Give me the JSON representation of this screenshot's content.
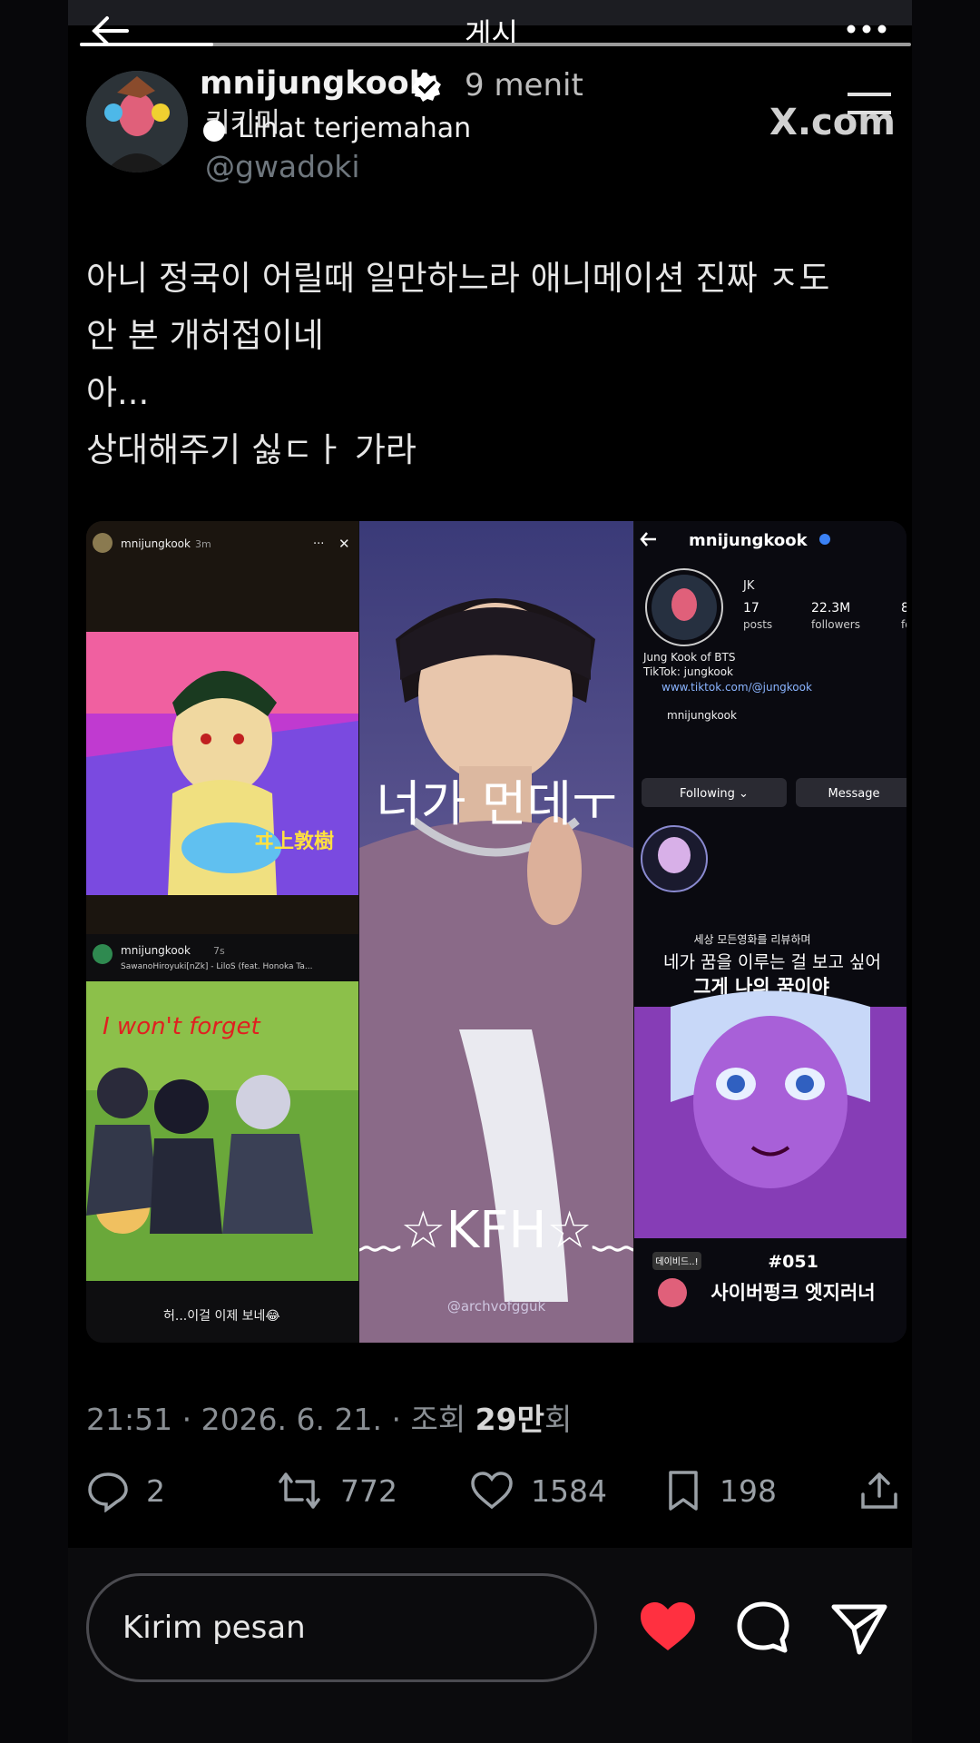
{
  "header": {
    "title": "게시",
    "back_label": "←",
    "more_label": "•••",
    "progress": 0.16
  },
  "post": {
    "username": "mnijungkook",
    "time": "9 menit",
    "overlay_korean": "키키미",
    "translate": "Lihat terjemahan",
    "handle": "@gwadoki",
    "source_logo": "X.com",
    "lines": [
      "아니 정국이 어릴때 일만하느라 애니메이션 진짜 ㅈ도",
      "안 본 개허접이네",
      "아...",
      "상대해주기 싫ㄷㅏ 가라"
    ],
    "timestamp": "21:51 · 2026. 6. 21. · 조회 ",
    "views_bold": "29만",
    "views_suffix": "회"
  },
  "media": {
    "left_top": {
      "user": "mnijungkook",
      "time": "3m",
      "more": "···",
      "close": "✕",
      "caption": "ヰ上敦樹"
    },
    "left_bottom": {
      "user": "mnijungkook",
      "time": "7s",
      "track": "SawanoHiroyuki[nZk] - LiloS (feat. Honoka Ta...",
      "scribble": "I won't forget",
      "caption": "허...이걸 이제 보네😂"
    },
    "center": {
      "overlay": "너가 먼데ㅜ",
      "watermark": "@archvofgguk",
      "kfh": "﹏☆KFH☆﹏"
    },
    "profile": {
      "name": "mnijungkook",
      "short": "JK",
      "posts_num": "17",
      "posts_label": "posts",
      "followers_num": "22.3M",
      "followers_label": "followers",
      "following_num": "8",
      "following_label": "fo",
      "bio1": "Jung Kook of BTS",
      "bio2": "TikTok: jungkook",
      "link": "www.tiktok.com/@jungkook",
      "threads": "mnijungkook",
      "following_btn": "Following ⌄",
      "message_btn": "Message",
      "review": "세상 모든영화를 리뷰하며",
      "quote1": "네가 꿈을 이루는 걸 보고 싶어",
      "quote2": "그게 나의 꿈이야",
      "tag": "데이비드..!",
      "episode": "#051",
      "episode_title": "사이버펑크 엣지러너"
    }
  },
  "actions": {
    "reply": "2",
    "repost": "772",
    "like": "1584",
    "bookmark": "198"
  },
  "composer": {
    "placeholder": "Kirim pesan"
  },
  "colors": {
    "heart": "#ff3040",
    "verified": "#ffffff",
    "link_blue": "#4d9cff"
  }
}
